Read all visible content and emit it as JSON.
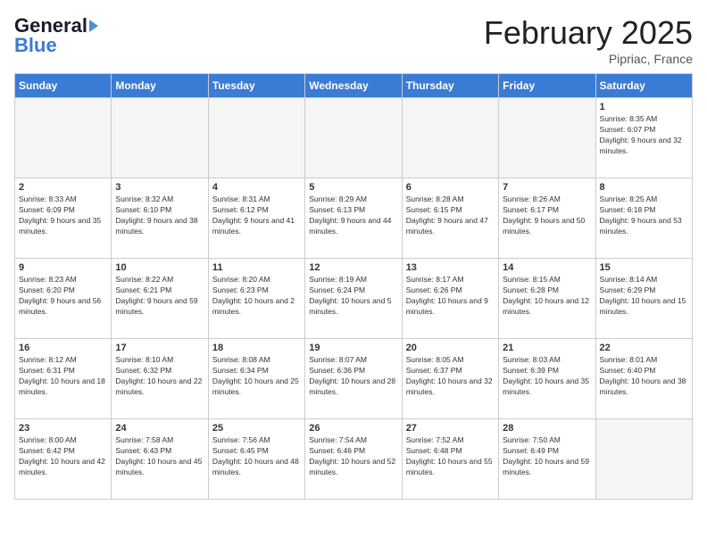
{
  "header": {
    "logo_general": "General",
    "logo_blue": "Blue",
    "month": "February 2025",
    "location": "Pipriac, France"
  },
  "weekdays": [
    "Sunday",
    "Monday",
    "Tuesday",
    "Wednesday",
    "Thursday",
    "Friday",
    "Saturday"
  ],
  "weeks": [
    [
      {
        "day": "",
        "info": ""
      },
      {
        "day": "",
        "info": ""
      },
      {
        "day": "",
        "info": ""
      },
      {
        "day": "",
        "info": ""
      },
      {
        "day": "",
        "info": ""
      },
      {
        "day": "",
        "info": ""
      },
      {
        "day": "1",
        "info": "Sunrise: 8:35 AM\nSunset: 6:07 PM\nDaylight: 9 hours and 32 minutes."
      }
    ],
    [
      {
        "day": "2",
        "info": "Sunrise: 8:33 AM\nSunset: 6:09 PM\nDaylight: 9 hours and 35 minutes."
      },
      {
        "day": "3",
        "info": "Sunrise: 8:32 AM\nSunset: 6:10 PM\nDaylight: 9 hours and 38 minutes."
      },
      {
        "day": "4",
        "info": "Sunrise: 8:31 AM\nSunset: 6:12 PM\nDaylight: 9 hours and 41 minutes."
      },
      {
        "day": "5",
        "info": "Sunrise: 8:29 AM\nSunset: 6:13 PM\nDaylight: 9 hours and 44 minutes."
      },
      {
        "day": "6",
        "info": "Sunrise: 8:28 AM\nSunset: 6:15 PM\nDaylight: 9 hours and 47 minutes."
      },
      {
        "day": "7",
        "info": "Sunrise: 8:26 AM\nSunset: 6:17 PM\nDaylight: 9 hours and 50 minutes."
      },
      {
        "day": "8",
        "info": "Sunrise: 8:25 AM\nSunset: 6:18 PM\nDaylight: 9 hours and 53 minutes."
      }
    ],
    [
      {
        "day": "9",
        "info": "Sunrise: 8:23 AM\nSunset: 6:20 PM\nDaylight: 9 hours and 56 minutes."
      },
      {
        "day": "10",
        "info": "Sunrise: 8:22 AM\nSunset: 6:21 PM\nDaylight: 9 hours and 59 minutes."
      },
      {
        "day": "11",
        "info": "Sunrise: 8:20 AM\nSunset: 6:23 PM\nDaylight: 10 hours and 2 minutes."
      },
      {
        "day": "12",
        "info": "Sunrise: 8:19 AM\nSunset: 6:24 PM\nDaylight: 10 hours and 5 minutes."
      },
      {
        "day": "13",
        "info": "Sunrise: 8:17 AM\nSunset: 6:26 PM\nDaylight: 10 hours and 9 minutes."
      },
      {
        "day": "14",
        "info": "Sunrise: 8:15 AM\nSunset: 6:28 PM\nDaylight: 10 hours and 12 minutes."
      },
      {
        "day": "15",
        "info": "Sunrise: 8:14 AM\nSunset: 6:29 PM\nDaylight: 10 hours and 15 minutes."
      }
    ],
    [
      {
        "day": "16",
        "info": "Sunrise: 8:12 AM\nSunset: 6:31 PM\nDaylight: 10 hours and 18 minutes."
      },
      {
        "day": "17",
        "info": "Sunrise: 8:10 AM\nSunset: 6:32 PM\nDaylight: 10 hours and 22 minutes."
      },
      {
        "day": "18",
        "info": "Sunrise: 8:08 AM\nSunset: 6:34 PM\nDaylight: 10 hours and 25 minutes."
      },
      {
        "day": "19",
        "info": "Sunrise: 8:07 AM\nSunset: 6:36 PM\nDaylight: 10 hours and 28 minutes."
      },
      {
        "day": "20",
        "info": "Sunrise: 8:05 AM\nSunset: 6:37 PM\nDaylight: 10 hours and 32 minutes."
      },
      {
        "day": "21",
        "info": "Sunrise: 8:03 AM\nSunset: 6:39 PM\nDaylight: 10 hours and 35 minutes."
      },
      {
        "day": "22",
        "info": "Sunrise: 8:01 AM\nSunset: 6:40 PM\nDaylight: 10 hours and 38 minutes."
      }
    ],
    [
      {
        "day": "23",
        "info": "Sunrise: 8:00 AM\nSunset: 6:42 PM\nDaylight: 10 hours and 42 minutes."
      },
      {
        "day": "24",
        "info": "Sunrise: 7:58 AM\nSunset: 6:43 PM\nDaylight: 10 hours and 45 minutes."
      },
      {
        "day": "25",
        "info": "Sunrise: 7:56 AM\nSunset: 6:45 PM\nDaylight: 10 hours and 48 minutes."
      },
      {
        "day": "26",
        "info": "Sunrise: 7:54 AM\nSunset: 6:46 PM\nDaylight: 10 hours and 52 minutes."
      },
      {
        "day": "27",
        "info": "Sunrise: 7:52 AM\nSunset: 6:48 PM\nDaylight: 10 hours and 55 minutes."
      },
      {
        "day": "28",
        "info": "Sunrise: 7:50 AM\nSunset: 6:49 PM\nDaylight: 10 hours and 59 minutes."
      },
      {
        "day": "",
        "info": ""
      }
    ]
  ]
}
